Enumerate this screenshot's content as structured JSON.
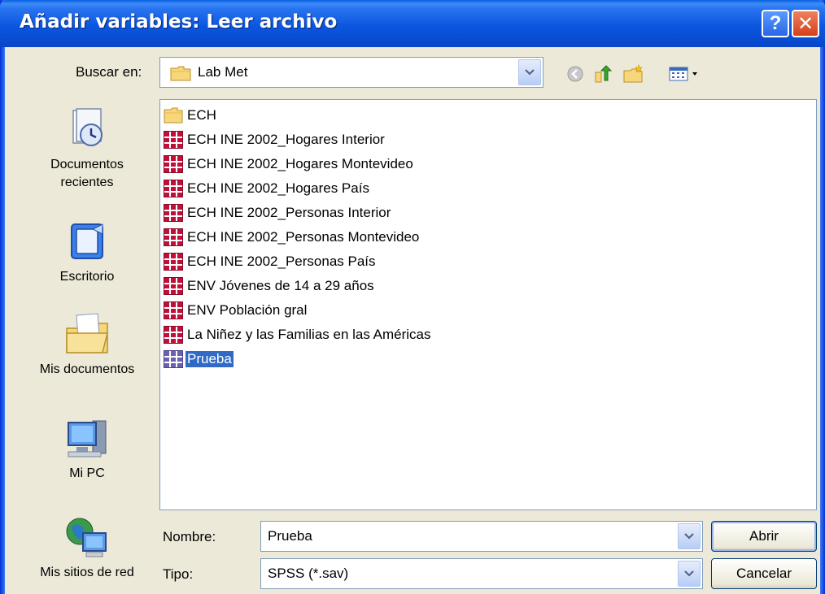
{
  "window": {
    "title": "Añadir variables: Leer archivo"
  },
  "lookin": {
    "label": "Buscar en:",
    "value": "Lab Met"
  },
  "places": [
    {
      "label": "Documentos recientes",
      "icon": "recent-documents-icon"
    },
    {
      "label": "Escritorio",
      "icon": "desktop-icon"
    },
    {
      "label": "Mis documentos",
      "icon": "my-documents-icon"
    },
    {
      "label": "Mi PC",
      "icon": "my-computer-icon"
    },
    {
      "label": "Mis sitios de red",
      "icon": "network-places-icon"
    }
  ],
  "files": [
    {
      "name": "ECH",
      "type": "folder"
    },
    {
      "name": "ECH INE 2002_Hogares Interior",
      "type": "sav"
    },
    {
      "name": "ECH INE 2002_Hogares Montevideo",
      "type": "sav"
    },
    {
      "name": "ECH INE 2002_Hogares País",
      "type": "sav"
    },
    {
      "name": "ECH INE 2002_Personas Interior",
      "type": "sav"
    },
    {
      "name": "ECH INE 2002_Personas Montevideo",
      "type": "sav"
    },
    {
      "name": "ECH INE 2002_Personas País",
      "type": "sav"
    },
    {
      "name": "ENV Jóvenes de 14 a 29 años",
      "type": "sav"
    },
    {
      "name": "ENV Población gral",
      "type": "sav"
    },
    {
      "name": "La Niñez y las Familias en las Américas",
      "type": "sav"
    },
    {
      "name": "Prueba",
      "type": "sav",
      "selected": true
    }
  ],
  "filename": {
    "label": "Nombre:",
    "value": "Prueba"
  },
  "filetype": {
    "label": "Tipo:",
    "value": "SPSS (*.sav)"
  },
  "buttons": {
    "open": "Abrir",
    "cancel": "Cancelar"
  },
  "colors": {
    "titlebar": "#0a4cd0",
    "selection": "#316ac5",
    "sav_icon": "#c0103a"
  }
}
